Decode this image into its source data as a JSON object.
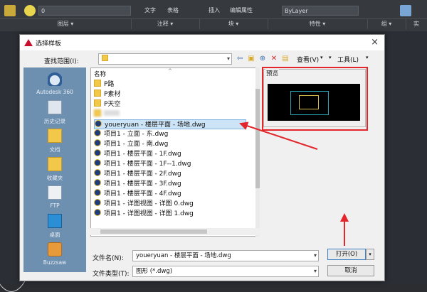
{
  "ribbon": {
    "layer_value": "0",
    "text_label": "文字",
    "table_label": "表格",
    "insert_label": "插入",
    "edit_attr_label": "编辑属性",
    "bylayer_value": "ByLayer",
    "groups": [
      "图层 ▾",
      "注释 ▾",
      "块 ▾",
      "特性 ▾",
      "组 ▾",
      "实"
    ]
  },
  "dialog": {
    "title": "选择样板",
    "close": "×",
    "look_in_label": "查找范围(I):",
    "look_in_value": "",
    "view_label": "查看(V)",
    "tools_label": "工具(L)",
    "places": [
      {
        "name": "Autodesk 360",
        "icon": "cloud-icon"
      },
      {
        "name": "历史记录",
        "icon": "history-icon"
      },
      {
        "name": "文档",
        "icon": "documents-icon"
      },
      {
        "name": "收藏夹",
        "icon": "favorites-icon"
      },
      {
        "name": "FTP",
        "icon": "ftp-icon"
      },
      {
        "name": "桌面",
        "icon": "desktop-icon"
      },
      {
        "name": "Buzzsaw",
        "icon": "buzzsaw-icon"
      }
    ],
    "list_header": "名称",
    "folders": [
      "P路",
      "P素材",
      "P天空"
    ],
    "files": [
      "youeryuan - 楼层平面 - 场地.dwg",
      "项目1 - 立面 - 东.dwg",
      "项目1 - 立面 - 南.dwg",
      "项目1 - 楼层平面 - 1F.dwg",
      "项目1 - 楼层平面 - 1F--1.dwg",
      "项目1 - 楼层平面 - 2F.dwg",
      "项目1 - 楼层平面 - 3F.dwg",
      "项目1 - 楼层平面 - 4F.dwg",
      "项目1 - 详图视图 - 详图 0.dwg",
      "项目1 - 详图视图 - 详图 1.dwg"
    ],
    "preview_label": "预览",
    "filename_label": "文件名(N):",
    "filename_value": "youeryuan - 楼层平面 - 场地.dwg",
    "filetype_label": "文件类型(T):",
    "filetype_value": "图形 (*.dwg)",
    "open_label": "打开(O)",
    "cancel_label": "取消"
  },
  "colors": {
    "highlight_red": "#e3262b",
    "places_bg": "#6d8fb0",
    "selection": "#cde4f7"
  }
}
